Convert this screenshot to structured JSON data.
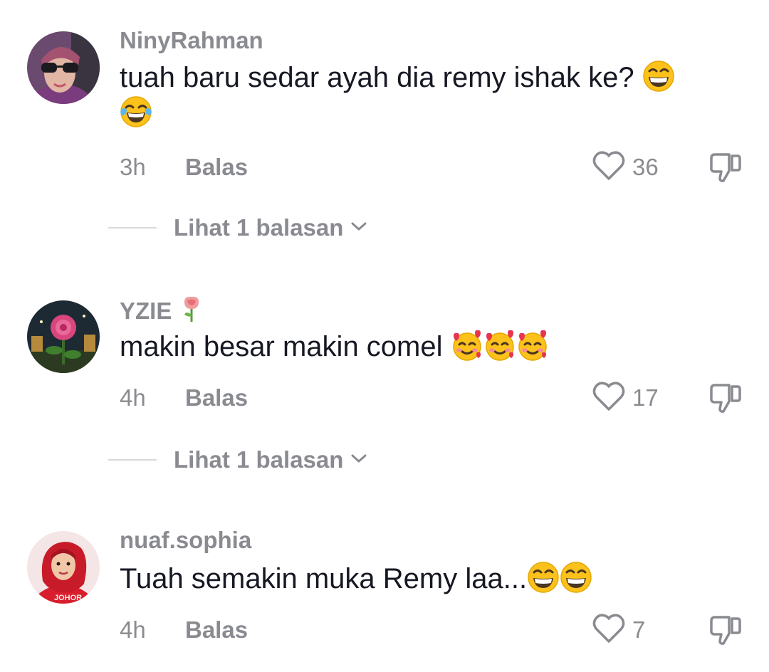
{
  "comments": [
    {
      "username": "NinyRahman",
      "username_emoji": "",
      "text": "tuah baru sedar ayah dia remy ishak ke?",
      "emojis": [
        "grinning-face",
        "tears-of-joy-face"
      ],
      "time": "3h",
      "reply_label": "Balas",
      "likes": "36",
      "view_replies": "Lihat 1 balasan"
    },
    {
      "username": "YZIE",
      "username_emoji": "rose",
      "text": "makin besar makin comel",
      "emojis": [
        "smiling-face-with-hearts",
        "smiling-face-with-hearts",
        "smiling-face-with-hearts"
      ],
      "time": "4h",
      "reply_label": "Balas",
      "likes": "17",
      "view_replies": "Lihat 1 balasan"
    },
    {
      "username": "nuaf.sophia",
      "username_emoji": "",
      "text": "Tuah semakin muka Remy laa...",
      "emojis": [
        "grinning-face",
        "grinning-face"
      ],
      "time": "4h",
      "reply_label": "Balas",
      "likes": "7",
      "view_replies": ""
    }
  ],
  "avatar_badge_text": "JOHOR",
  "colors": {
    "text_primary": "#161823",
    "text_secondary": "#8a8b91",
    "divider": "#d9d9db"
  }
}
